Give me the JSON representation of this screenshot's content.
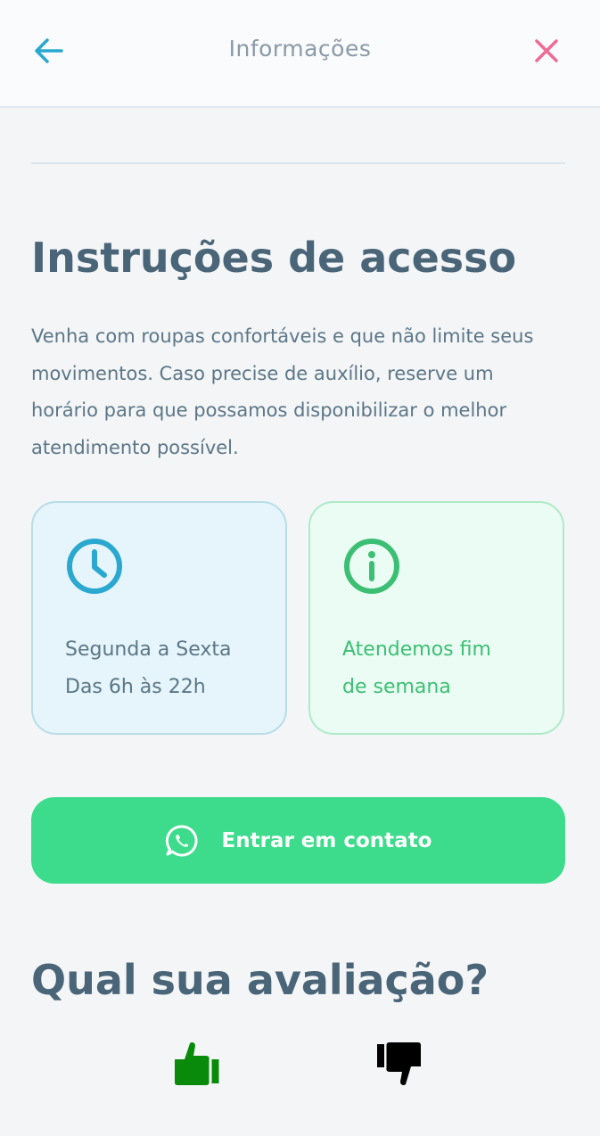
{
  "header": {
    "title": "Informações",
    "back_icon": "arrow-left-icon",
    "close_icon": "close-icon",
    "back_color": "#2aa8cf",
    "close_color": "#ef6a94"
  },
  "access": {
    "title": "Instruções de acesso",
    "description": "Venha com roupas confortáveis e que não limite seus movimentos. Caso precise de auxílio, reserve um horário para que possamos disponibilizar o melhor atendimento possível."
  },
  "cards": [
    {
      "icon": "clock-icon",
      "line1": "Segunda a Sexta",
      "line2": "Das 6h às 22h",
      "color": "#2aa8cf"
    },
    {
      "icon": "info-icon",
      "line1": "Atendemos fim",
      "line2": "de semana",
      "color": "#3cbf74"
    }
  ],
  "contact_button": {
    "label": "Entrar em contato",
    "icon": "whatsapp-icon",
    "color": "#3ddc8c"
  },
  "rating": {
    "title": "Qual sua avaliação?",
    "like_icon": "thumbs-up-icon",
    "dislike_icon": "thumbs-down-icon",
    "like_color": "#0a8a0a",
    "dislike_color": "#000000"
  }
}
